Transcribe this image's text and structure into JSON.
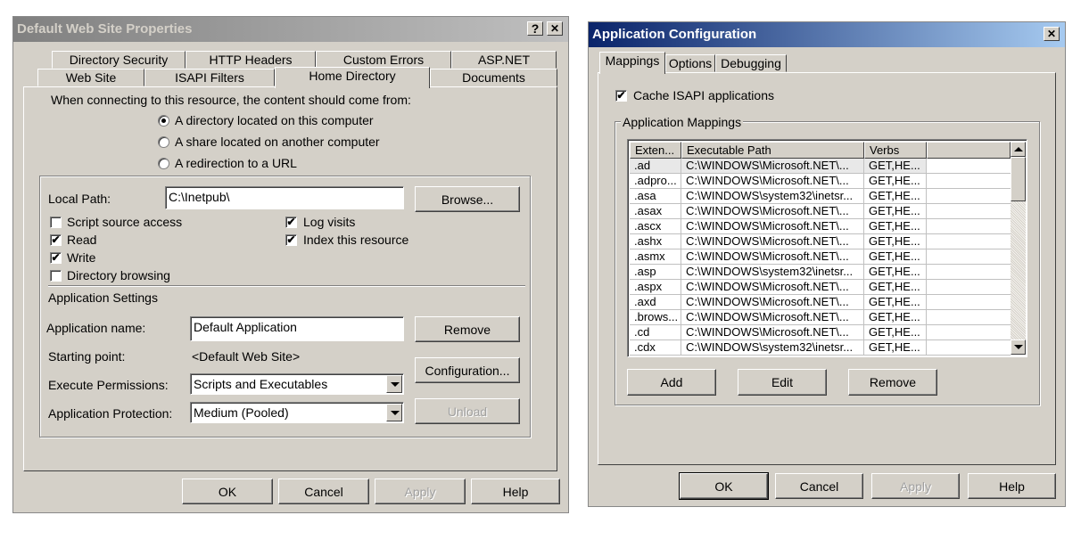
{
  "props_dialog": {
    "title": "Default Web Site Properties",
    "help_glyph": "?",
    "close_glyph": "✕",
    "tabs_row1": [
      "Directory Security",
      "HTTP Headers",
      "Custom Errors",
      "ASP.NET"
    ],
    "tabs_row2": [
      "Web Site",
      "ISAPI Filters",
      "Home Directory",
      "Documents"
    ],
    "active_tab": "Home Directory",
    "intro": "When connecting to this resource, the content should come from:",
    "radios": [
      {
        "label": "A directory located on this computer",
        "selected": true
      },
      {
        "label": "A share located on another computer",
        "selected": false
      },
      {
        "label": "A redirection to a URL",
        "selected": false
      }
    ],
    "local_path_label": "Local Path:",
    "local_path_value": "C:\\Inetpub\\",
    "browse_label": "Browse...",
    "checkboxes_left": [
      {
        "label": "Script source access",
        "checked": false
      },
      {
        "label": "Read",
        "checked": true
      },
      {
        "label": "Write",
        "checked": true
      },
      {
        "label": "Directory browsing",
        "checked": false
      }
    ],
    "checkboxes_right": [
      {
        "label": "Log visits",
        "checked": true
      },
      {
        "label": "Index this resource",
        "checked": true
      }
    ],
    "check_glyph": "✔",
    "app_settings_label": "Application Settings",
    "app_name_label": "Application name:",
    "app_name_value": "Default Application",
    "remove_label": "Remove",
    "starting_point_label": "Starting point:",
    "starting_point_value": "<Default Web Site>",
    "configuration_label": "Configuration...",
    "exec_perm_label": "Execute Permissions:",
    "exec_perm_value": "Scripts and Executables",
    "app_prot_label": "Application Protection:",
    "app_prot_value": "Medium (Pooled)",
    "unload_label": "Unload",
    "ok_label": "OK",
    "cancel_label": "Cancel",
    "apply_label": "Apply",
    "help_label": "Help"
  },
  "app_config": {
    "title": "Application Configuration",
    "close_glyph": "✕",
    "tabs": [
      "Mappings",
      "Options",
      "Debugging"
    ],
    "active_tab": "Mappings",
    "cache_isapi_label": "Cache ISAPI applications",
    "cache_isapi_checked": true,
    "check_glyph": "✔",
    "mappings_group_label": "Application Mappings",
    "columns": [
      "Exten...",
      "Executable Path",
      "Verbs"
    ],
    "rows": [
      [
        ".ad",
        "C:\\WINDOWS\\Microsoft.NET\\...",
        "GET,HE..."
      ],
      [
        ".adpro...",
        "C:\\WINDOWS\\Microsoft.NET\\...",
        "GET,HE..."
      ],
      [
        ".asa",
        "C:\\WINDOWS\\system32\\inetsr...",
        "GET,HE..."
      ],
      [
        ".asax",
        "C:\\WINDOWS\\Microsoft.NET\\...",
        "GET,HE..."
      ],
      [
        ".ascx",
        "C:\\WINDOWS\\Microsoft.NET\\...",
        "GET,HE..."
      ],
      [
        ".ashx",
        "C:\\WINDOWS\\Microsoft.NET\\...",
        "GET,HE..."
      ],
      [
        ".asmx",
        "C:\\WINDOWS\\Microsoft.NET\\...",
        "GET,HE..."
      ],
      [
        ".asp",
        "C:\\WINDOWS\\system32\\inetsr...",
        "GET,HE..."
      ],
      [
        ".aspx",
        "C:\\WINDOWS\\Microsoft.NET\\...",
        "GET,HE..."
      ],
      [
        ".axd",
        "C:\\WINDOWS\\Microsoft.NET\\...",
        "GET,HE..."
      ],
      [
        ".brows...",
        "C:\\WINDOWS\\Microsoft.NET\\...",
        "GET,HE..."
      ],
      [
        ".cd",
        "C:\\WINDOWS\\Microsoft.NET\\...",
        "GET,HE..."
      ],
      [
        ".cdx",
        "C:\\WINDOWS\\system32\\inetsr...",
        "GET,HE..."
      ]
    ],
    "add_label": "Add",
    "edit_label": "Edit",
    "remove_label": "Remove",
    "ok_label": "OK",
    "cancel_label": "Cancel",
    "apply_label": "Apply",
    "help_label": "Help"
  }
}
